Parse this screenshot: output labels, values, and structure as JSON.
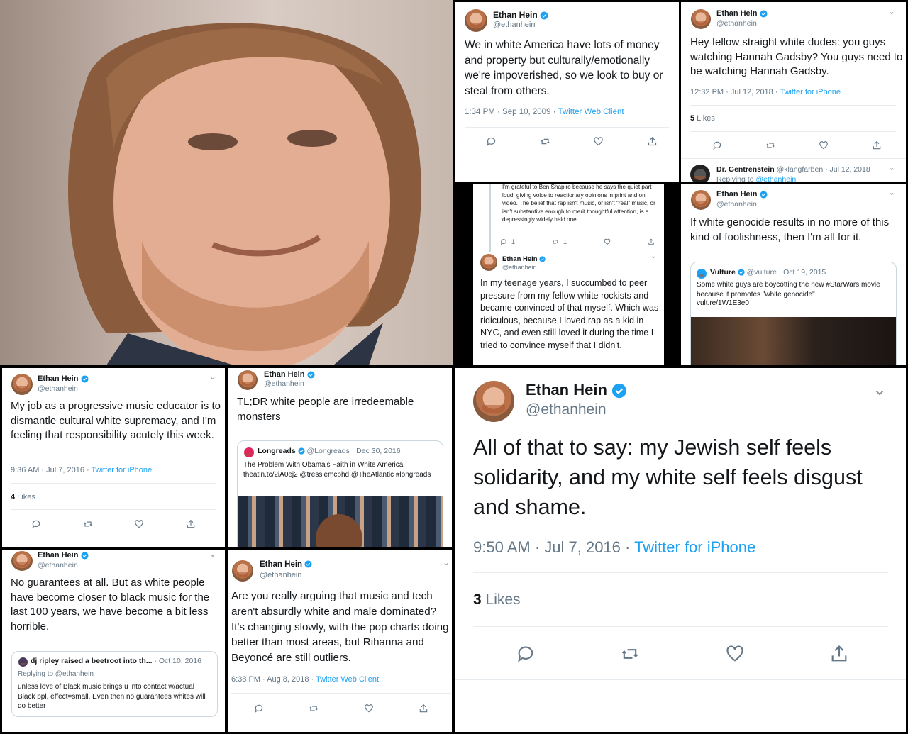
{
  "profile": {
    "name": "Ethan Hein",
    "handle": "@ethanhein"
  },
  "t1": {
    "text": "We in white America have lots of money and property but culturally/emotionally we're impoverished, so we look to buy or steal from others.",
    "date": "1:34 PM · Sep 10, 2009 · ",
    "source": "Twitter Web Client"
  },
  "t2": {
    "text": "Hey fellow straight white dudes: you guys watching Hannah Gadsby? You guys need to be watching Hannah Gadsby.",
    "date": "12:32 PM · Jul 12, 2018 · ",
    "source": "Twitter for iPhone",
    "likes_count": "5",
    "likes_label": " Likes",
    "reply": {
      "name": "Dr. Gentrenstein",
      "handle": "@klangfarben · Jul 12, 2018",
      "replying": "Replying to ",
      "replying_handle": "@ethanhein"
    }
  },
  "t3": {
    "prev_text": "I'm grateful to Ben Shapiro because he says the quiet part loud, giving voice to reactionary opinions in print and on video. The belief that rap isn't music, or isn't \"real\" music, or isn't substantive enough to merit thoughtful attention, is a depressingly widely held one.",
    "reply_count": "1",
    "rt_count": "1",
    "text": "In my teenage years, I succumbed to peer pressure from my fellow white rockists and became convinced of that myself. Which was ridiculous, because I loved rap as a kid in NYC, and even still loved it during the time I tried to convince myself that I didn't."
  },
  "t4": {
    "text": "If white genocide results in no more of this kind of foolishness, then I'm all for it.",
    "quote": {
      "name": "Vulture",
      "handle": "@vulture · Oct 19, 2015",
      "text": "Some white guys are boycotting the new #StarWars movie because it promotes \"white genocide\"",
      "link": "vult.re/1W1E3e0"
    }
  },
  "t5": {
    "text": "My job as a progressive music educator is to dismantle cultural white supremacy, and I'm feeling that responsibility acutely this week.",
    "date": "9:36 AM · Jul 7, 2016 · ",
    "source": "Twitter for iPhone",
    "likes_count": "4",
    "likes_label": " Likes"
  },
  "t6": {
    "text": "TL;DR white people are irredeemable monsters",
    "quote": {
      "name": "Longreads",
      "handle": "@Longreads · Dec 30, 2016",
      "text": "The Problem With Obama's Faith in White America theatln.tc/2iA0ej2 @tressiemcphd @TheAtlantic #longreads"
    }
  },
  "t7": {
    "text": "All of that to say: my Jewish self feels solidarity, and my white self feels disgust and shame.",
    "date": "9:50 AM · Jul 7, 2016 · ",
    "source": "Twitter for iPhone",
    "likes_count": "3",
    "likes_label": " Likes"
  },
  "t8": {
    "text": "No guarantees at all. But as white people have become closer to black music for the last 100 years, we have become a bit less horrible.",
    "quote": {
      "name": "dj ripley raised a beetroot into th...",
      "date": "· Oct 10, 2016",
      "replying": "Replying to @ethanhein",
      "text": "unless love of Black music brings u into contact w/actual Black ppl, effect=small. Even then no guarantees whites will do better"
    }
  },
  "t9": {
    "text": "Are you really arguing that music and tech aren't absurdly white and male dominated? It's changing slowly, with the pop charts doing better than most areas, but Rihanna and Beyoncé are still outliers.",
    "date": "6:38 PM · Aug 8, 2018 · ",
    "source": "Twitter Web Client"
  },
  "colors": {
    "accent": "#1da1f2",
    "text": "#14171a",
    "muted": "#657786"
  },
  "icons": [
    "reply-icon",
    "retweet-icon",
    "like-icon",
    "share-icon",
    "verified-badge-icon",
    "chevron-down-icon"
  ]
}
